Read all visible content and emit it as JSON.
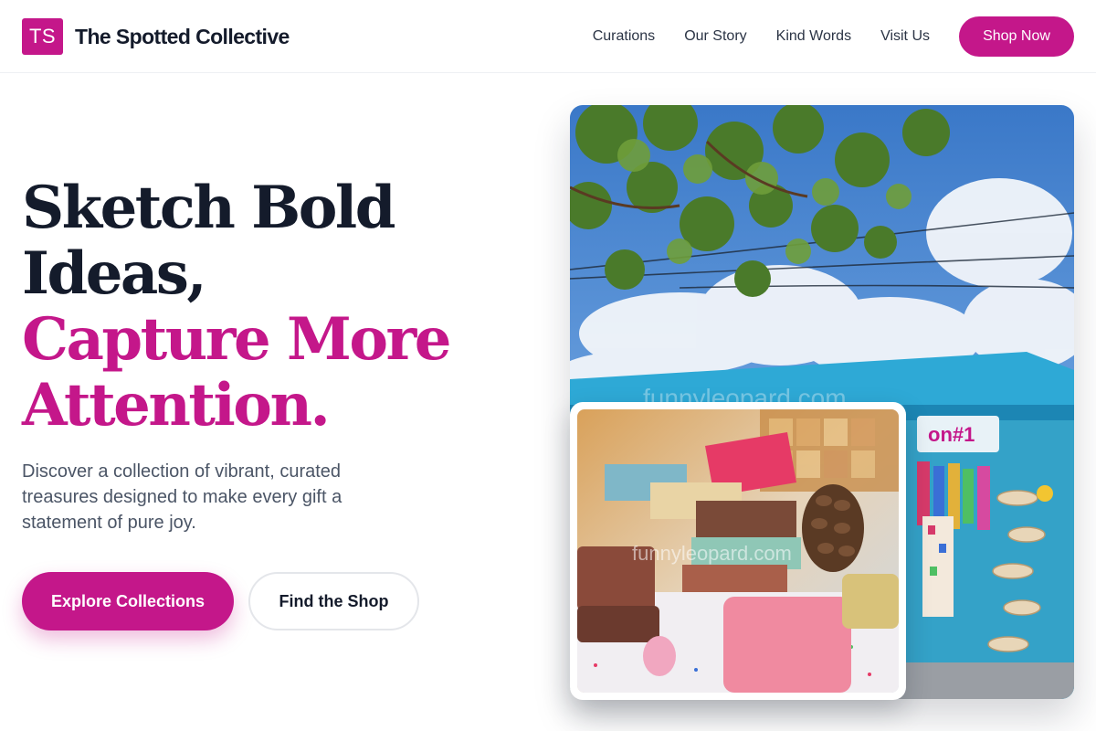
{
  "brand": {
    "mark": "TS",
    "name": "The Spotted Collective",
    "accent_color": "#c4178a",
    "text_color": "#141b2b"
  },
  "nav": {
    "links": [
      "Curations",
      "Our Story",
      "Kind Words",
      "Visit Us"
    ],
    "cta": "Shop Now"
  },
  "hero": {
    "headline_dark_1": "Sketch Bold",
    "headline_dark_2": "Ideas,",
    "headline_pink_1": "Capture More",
    "headline_pink_2": "Attention.",
    "lead": "Discover a collection of vibrant, curated treasures designed to make every gift a statement of pure joy.",
    "primary_cta": "Explore Collections",
    "secondary_cta": "Find the Shop"
  },
  "images": {
    "main": "colorful-souvenir-shop-storefront-photo",
    "inset": "handmade-soaps-and-pinecone-photo",
    "watermark_main": "funnyleopard.com",
    "watermark_inset": "funnyleopard.com"
  }
}
